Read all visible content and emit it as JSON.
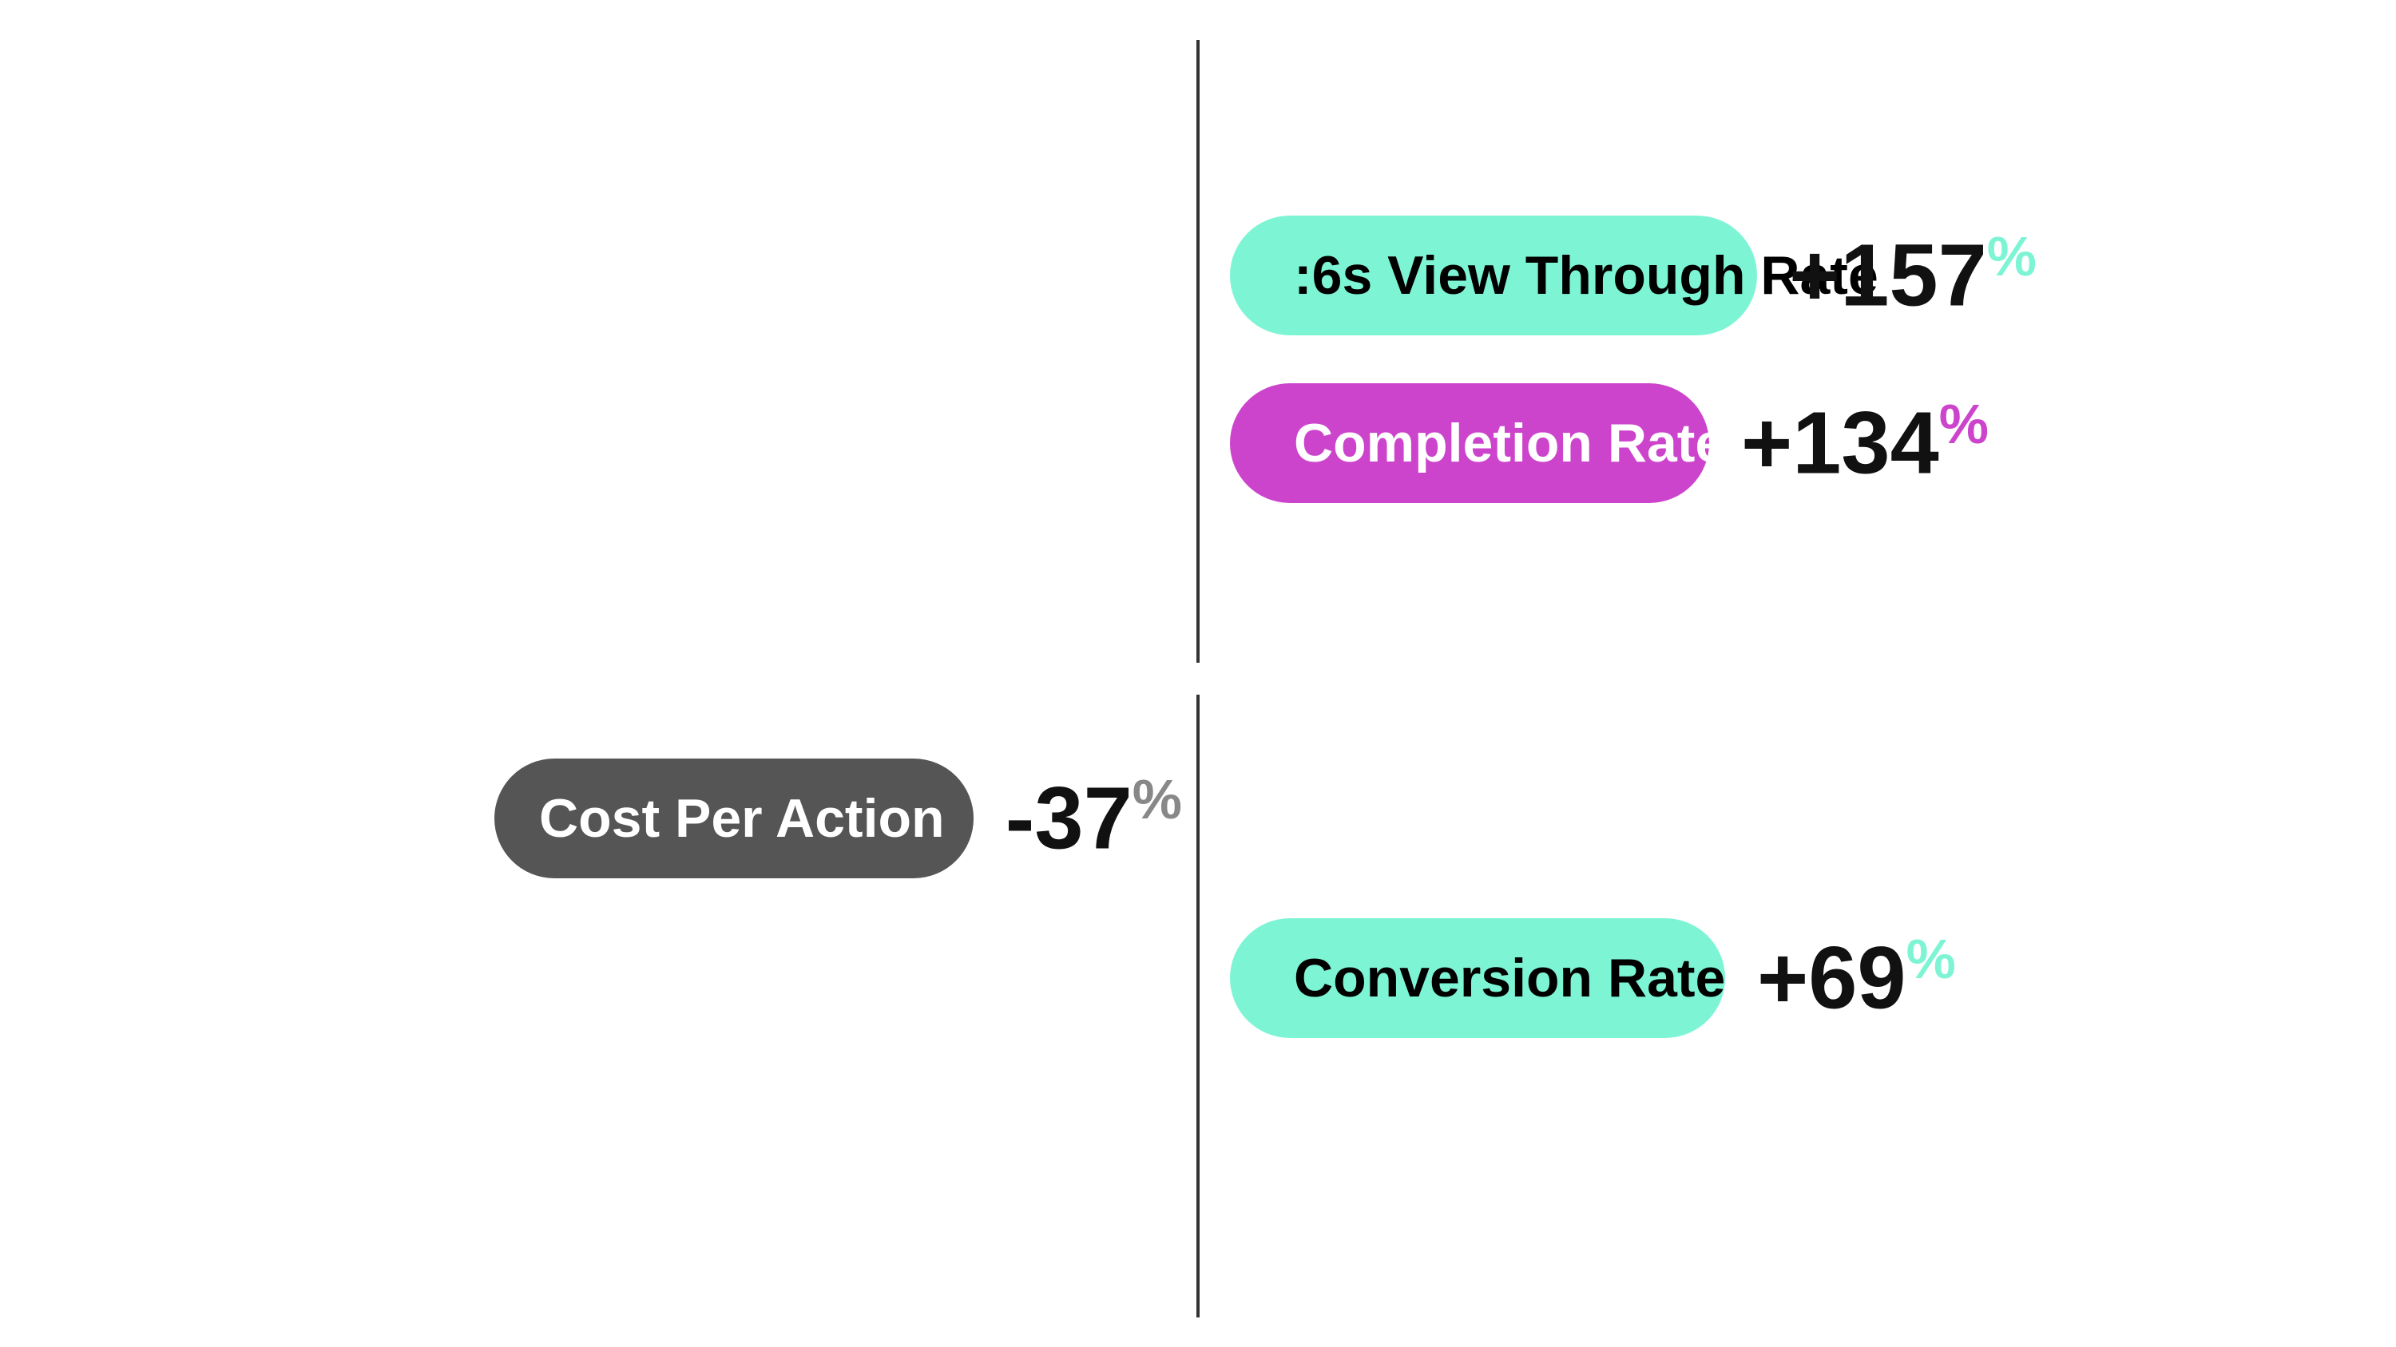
{
  "bars": {
    "view_through_rate": {
      "label": ":6s View Through Rate",
      "value": "+157",
      "percent_symbol": "%",
      "color": "#7DF5D5",
      "text_color": "#111111",
      "direction": "right"
    },
    "completion_rate": {
      "label": "Completion Rate",
      "value": "+134",
      "percent_symbol": "%",
      "color": "#CC44CC",
      "text_color": "#111111",
      "direction": "right"
    },
    "cost_per_action": {
      "label": "Cost Per Action",
      "value": "-37",
      "percent_symbol": "%",
      "color": "#555555",
      "text_color": "#ffffff",
      "direction": "left"
    },
    "conversion_rate": {
      "label": "Conversion Rate",
      "value": "+69",
      "percent_symbol": "%",
      "color": "#7DF5D5",
      "text_color": "#111111",
      "direction": "right"
    }
  }
}
